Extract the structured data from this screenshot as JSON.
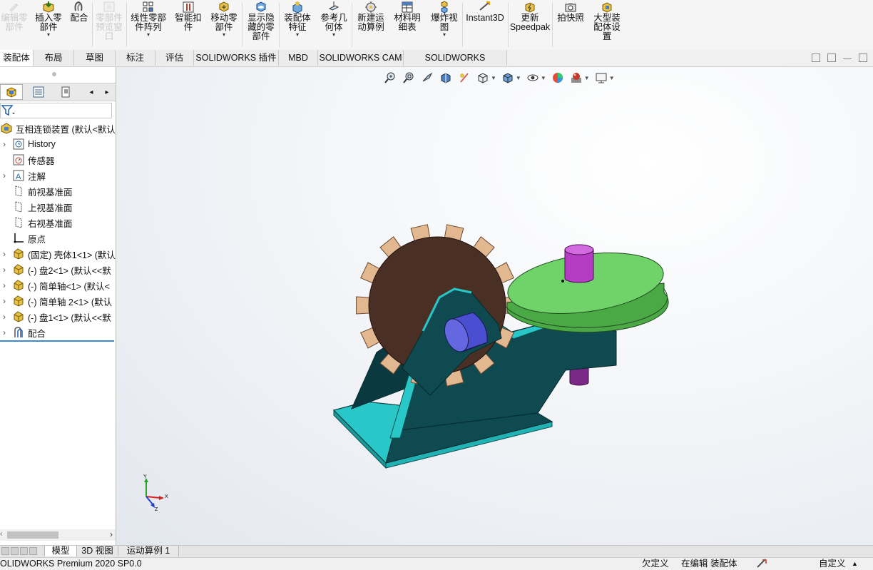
{
  "ribbon": {
    "buttons": [
      {
        "label": "编辑零\n部件",
        "disabled": true,
        "icon": "edit-component-icon",
        "dropdown": false
      },
      {
        "label": "插入零\n部件",
        "disabled": false,
        "icon": "insert-component-icon",
        "dropdown": true
      },
      {
        "label": "配合",
        "disabled": false,
        "icon": "mate-icon",
        "dropdown": false
      },
      {
        "label": "零部件\n预览窗\n口",
        "disabled": true,
        "icon": "component-preview-icon",
        "dropdown": false
      },
      {
        "label": "线性零部\n件阵列",
        "disabled": false,
        "icon": "linear-pattern-icon",
        "dropdown": true
      },
      {
        "label": "智能扣\n件",
        "disabled": false,
        "icon": "smart-fasteners-icon",
        "dropdown": false
      },
      {
        "label": "移动零\n部件",
        "disabled": false,
        "icon": "move-component-icon",
        "dropdown": true
      },
      {
        "label": "显示隐\n藏的零\n部件",
        "disabled": false,
        "icon": "show-hidden-icon",
        "dropdown": false
      },
      {
        "label": "装配体\n特征",
        "disabled": false,
        "icon": "assembly-features-icon",
        "dropdown": true
      },
      {
        "label": "参考几\n何体",
        "disabled": false,
        "icon": "reference-geometry-icon",
        "dropdown": true
      },
      {
        "label": "新建运\n动算例",
        "disabled": false,
        "icon": "new-motion-study-icon",
        "dropdown": false
      },
      {
        "label": "材料明\n细表",
        "disabled": false,
        "icon": "bill-of-materials-icon",
        "dropdown": false
      },
      {
        "label": "爆炸视\n图",
        "disabled": false,
        "icon": "exploded-view-icon",
        "dropdown": true
      },
      {
        "label": "Instant3D",
        "disabled": false,
        "icon": "instant3d-icon",
        "dropdown": false
      },
      {
        "label": "更新\nSpeedpak",
        "disabled": false,
        "icon": "speedpak-icon",
        "dropdown": false
      },
      {
        "label": "拍快照",
        "disabled": false,
        "icon": "snapshot-icon",
        "dropdown": false
      },
      {
        "label": "大型装\n配体设\n置",
        "disabled": false,
        "icon": "large-assembly-icon",
        "dropdown": false
      }
    ]
  },
  "tabs": [
    "装配体",
    "布局",
    "草图",
    "标注",
    "评估",
    "SOLIDWORKS 插件",
    "MBD",
    "SOLIDWORKS CAM",
    "SOLIDWORKS Inspection"
  ],
  "active_tab": "装配体",
  "tree": {
    "root": "互相连锁装置 (默认<默认",
    "items": [
      {
        "label": "History",
        "expandable": true,
        "icon": "history-icon"
      },
      {
        "label": "传感器",
        "expandable": false,
        "icon": "sensor-icon"
      },
      {
        "label": "注解",
        "expandable": true,
        "icon": "annotation-icon"
      },
      {
        "label": "前视基准面",
        "expandable": false,
        "icon": "plane-icon"
      },
      {
        "label": "上视基准面",
        "expandable": false,
        "icon": "plane-icon"
      },
      {
        "label": "右视基准面",
        "expandable": false,
        "icon": "plane-icon"
      },
      {
        "label": "原点",
        "expandable": false,
        "icon": "origin-icon"
      },
      {
        "label": "(固定) 壳体1<1> (默认",
        "expandable": true,
        "icon": "part-icon"
      },
      {
        "label": "(-) 盘2<1> (默认<<默",
        "expandable": true,
        "icon": "part-icon"
      },
      {
        "label": "(-) 简单轴<1> (默认<",
        "expandable": true,
        "icon": "part-icon"
      },
      {
        "label": "(-) 简单轴 2<1> (默认",
        "expandable": true,
        "icon": "part-icon"
      },
      {
        "label": "(-) 盘1<1> (默认<<默",
        "expandable": true,
        "icon": "part-icon"
      },
      {
        "label": "配合",
        "expandable": true,
        "icon": "mates-folder-icon"
      }
    ]
  },
  "bottom_tabs": [
    "模型",
    "3D 视图",
    "运动算例 1"
  ],
  "status": {
    "product": "OLIDWORKS Premium 2020 SP0.0",
    "definition": "欠定义",
    "editing": "在编辑 装配体",
    "custom": "自定义"
  },
  "colors": {
    "gear": "#4a2f25",
    "teeth": "#e2b890",
    "bracket": "#0e4a50",
    "base": "#29c7c7",
    "disk": "#6fd36a",
    "pin_top": "#b43cc2",
    "shaft": "#4a4ed0"
  }
}
